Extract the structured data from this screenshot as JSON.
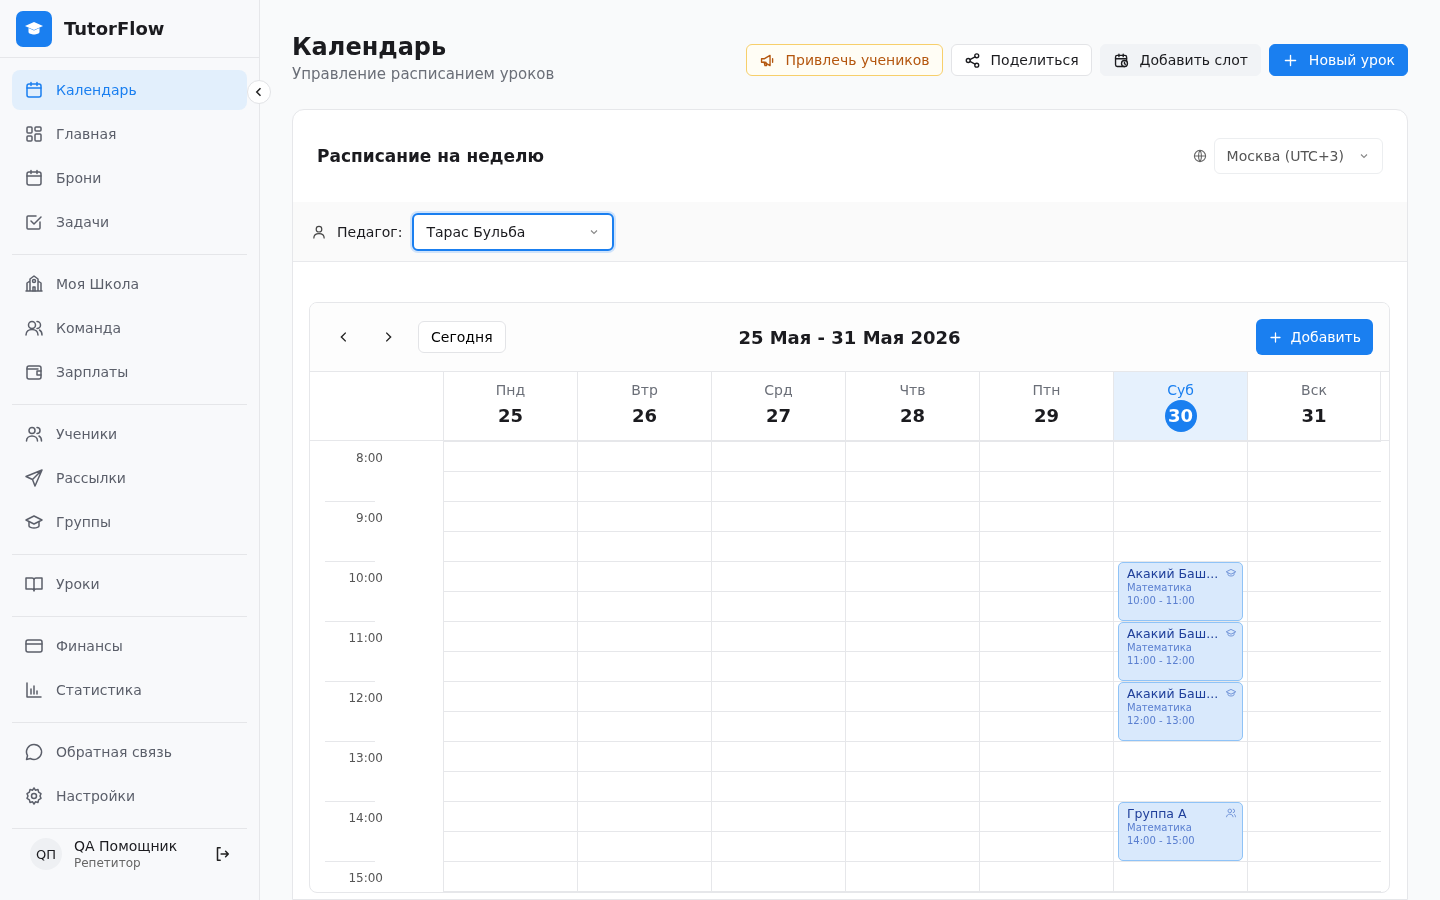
{
  "app": {
    "name": "TutorFlow"
  },
  "sidebar": {
    "groups": [
      {
        "items": [
          {
            "label": "Календарь",
            "selected": true
          },
          {
            "label": "Главная",
            "selected": false
          },
          {
            "label": "Брони",
            "selected": false
          },
          {
            "label": "Задачи",
            "selected": false
          }
        ]
      },
      {
        "items": [
          {
            "label": "Моя Школа",
            "selected": false
          },
          {
            "label": "Команда",
            "selected": false
          },
          {
            "label": "Зарплаты",
            "selected": false
          }
        ]
      },
      {
        "items": [
          {
            "label": "Ученики",
            "selected": false
          },
          {
            "label": "Рассылки",
            "selected": false
          },
          {
            "label": "Группы",
            "selected": false
          }
        ]
      },
      {
        "items": [
          {
            "label": "Уроки",
            "selected": false
          }
        ]
      },
      {
        "items": [
          {
            "label": "Финансы",
            "selected": false
          },
          {
            "label": "Статистика",
            "selected": false
          }
        ]
      },
      {
        "items": [
          {
            "label": "Обратная связь",
            "selected": false
          },
          {
            "label": "Настройки",
            "selected": false
          }
        ]
      }
    ],
    "user": {
      "initials": "QП",
      "name": "QA Помощник",
      "role": "Репетитор"
    }
  },
  "page": {
    "title": "Календарь",
    "subtitle": "Управление расписанием уроков",
    "actions": [
      {
        "label": "Привлечь учеников",
        "kind": "promo"
      },
      {
        "label": "Поделиться",
        "kind": "share"
      },
      {
        "label": "Добавить слот",
        "kind": "slot"
      },
      {
        "label": "Новый урок",
        "kind": "primary"
      }
    ]
  },
  "schedule": {
    "title": "Расписание на неделю",
    "timezone": "Москва (UTC+3)",
    "teacher_label": "Педагог:",
    "teacher": "Тарас Бульба"
  },
  "calendar": {
    "today_button": "Сегодня",
    "range": "25 Мая - 31 Мая 2026",
    "add_button": "Добавить",
    "hours": [
      "8:00",
      "9:00",
      "10:00",
      "11:00",
      "12:00",
      "13:00",
      "14:00",
      "15:00"
    ],
    "days": [
      {
        "weekday": "Пнд",
        "date": "25",
        "selected": false
      },
      {
        "weekday": "Втр",
        "date": "26",
        "selected": false
      },
      {
        "weekday": "Срд",
        "date": "27",
        "selected": false
      },
      {
        "weekday": "Чтв",
        "date": "28",
        "selected": false
      },
      {
        "weekday": "Птн",
        "date": "29",
        "selected": false
      },
      {
        "weekday": "Суб",
        "date": "30",
        "selected": true,
        "events": [
          {
            "title": "Акакий Баш...",
            "subject": "Математика",
            "time": "10:00 - 11:00",
            "kind": "individual"
          },
          {
            "title": "Акакий Баш...",
            "subject": "Математика",
            "time": "11:00 - 12:00",
            "kind": "individual"
          },
          {
            "title": "Акакий Баш...",
            "subject": "Математика",
            "time": "12:00 - 13:00",
            "kind": "individual"
          },
          {
            "title": "Группа А",
            "subject": "Математика",
            "time": "14:00 - 15:00",
            "kind": "group"
          }
        ]
      },
      {
        "weekday": "Вск",
        "date": "31",
        "selected": false
      }
    ]
  }
}
